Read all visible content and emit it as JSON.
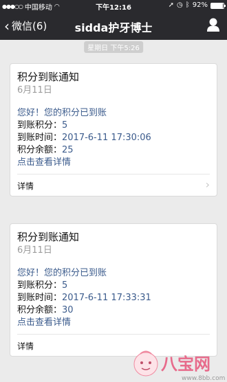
{
  "status": {
    "carrier": "中国移动",
    "time": "下午12:16",
    "battery": "92%",
    "battery_level": 0.92
  },
  "nav": {
    "back_label": "微信(6)",
    "title": "sidda护牙博士"
  },
  "timestamp": "星期日 下午5:26",
  "cards": [
    {
      "title": "积分到账通知",
      "date": "6月11日",
      "greeting": "您好！您的积分已到账",
      "points_label": "到账积分：",
      "points_value": "5",
      "time_label": "到账时间：",
      "time_value": "2017-6-11 17:30:06",
      "balance_label": "积分余额：",
      "balance_value": "25",
      "detail_link": "点击查看详情",
      "footer_label": "详情"
    },
    {
      "title": "积分到账通知",
      "date": "6月11日",
      "greeting": "您好！您的积分已到账",
      "points_label": "到账积分：",
      "points_value": "5",
      "time_label": "到账时间：",
      "time_value": "2017-6-11 17:33:31",
      "balance_label": "积分余额：",
      "balance_value": "30",
      "detail_link": "点击查看详情",
      "footer_label": "详情"
    }
  ],
  "watermark": {
    "text": "八宝网",
    "url": "www.8bb.com"
  }
}
